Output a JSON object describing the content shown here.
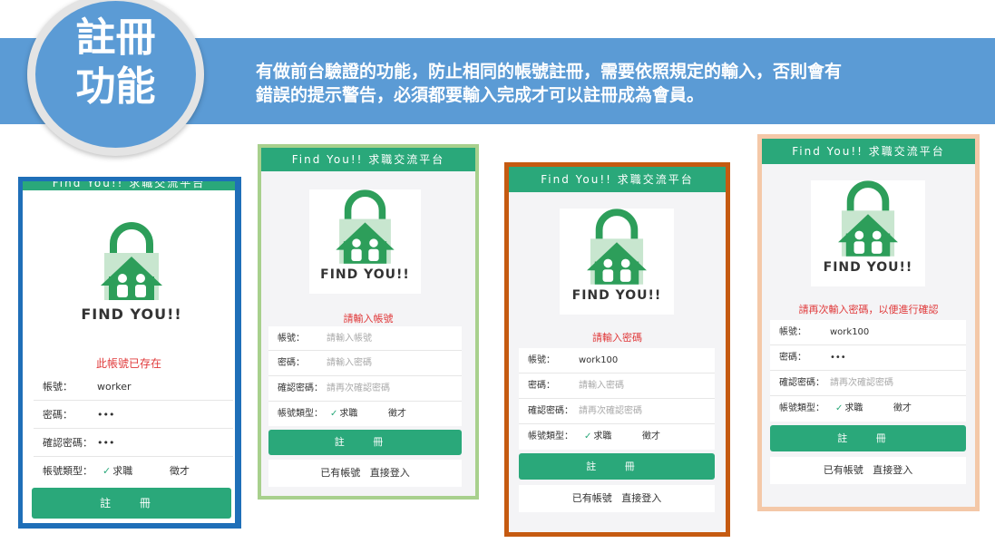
{
  "header": {
    "title_line1": "註冊",
    "title_line2": "功能",
    "description_line1": "有做前台驗證的功能，防止相同的帳號註冊，需要依照規定的輸入，否則會有",
    "description_line2": "錯誤的提示警告，必須都要輸入完成才可以註冊成為會員。"
  },
  "app": {
    "bar_title": "Find  You!!  求職交流平台",
    "logo_text": "FIND YOU!!",
    "labels": {
      "account": "帳號：",
      "password": "密碼：",
      "confirm": "確認密碼：",
      "type": "帳號類型：",
      "opt_job": "求職",
      "opt_recruit": "徵才",
      "register": "註 冊",
      "have_account": "已有帳號",
      "login": "直接登入"
    },
    "placeholders": {
      "account": "請輸入帳號",
      "password": "請輸入密碼",
      "confirm": "請再次確認密碼"
    }
  },
  "screens": [
    {
      "message": "此帳號已存在",
      "account": "worker",
      "password": "•••",
      "confirm": "•••",
      "border": "#1f6fb8"
    },
    {
      "message": "請輸入帳號",
      "account": "",
      "password": "",
      "confirm": "",
      "border": "#a8d08d"
    },
    {
      "message": "請輸入密碼",
      "account": "work100",
      "password": "",
      "confirm": "",
      "border": "#c55a11"
    },
    {
      "message": "請再次輸入密碼，以便進行確認",
      "account": "work100",
      "password": "•••",
      "confirm": "",
      "border": "#f4b183"
    }
  ],
  "colors": {
    "banner": "#5b9bd5",
    "accent": "#2aa87a",
    "error": "#e0393a"
  }
}
